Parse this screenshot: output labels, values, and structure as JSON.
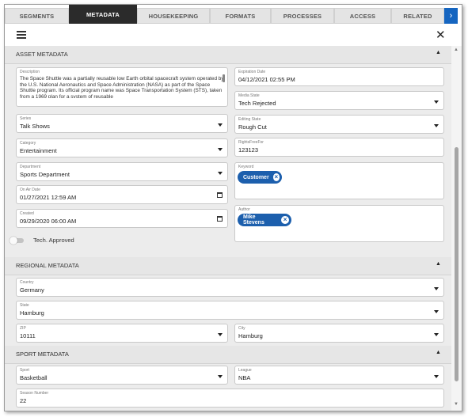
{
  "tabs": [
    "SEGMENTS",
    "METADATA",
    "HOUSEKEEPING",
    "FORMATS",
    "PROCESSES",
    "ACCESS",
    "RELATED"
  ],
  "active_tab": "METADATA",
  "asset_metadata": {
    "title": "ASSET METADATA",
    "description": {
      "label": "Description",
      "value": "The Space Shuttle was a partially reusable low Earth orbital spacecraft system operated by the U.S. National Aeronautics and Space Administration (NASA) as part of the Space Shuttle program. Its official program name was Space Transportation System (STS), taken from a 1969 plan for a system of reusable"
    },
    "series": {
      "label": "Series",
      "value": "Talk Shows"
    },
    "category": {
      "label": "Category",
      "value": "Entertainment"
    },
    "department": {
      "label": "Department",
      "value": "Sports Department"
    },
    "on_air_date": {
      "label": "On Air Date",
      "value": "01/27/2021 12:59 AM"
    },
    "created": {
      "label": "Created",
      "value": "09/29/2020 06:00 AM"
    },
    "tech_approved": {
      "label": "Tech. Approved",
      "value": false
    },
    "expiration_date": {
      "label": "Expiration Date",
      "value": "04/12/2021 02:55 PM"
    },
    "media_state": {
      "label": "Media State",
      "value": "Tech Rejected"
    },
    "editing_state": {
      "label": "Editing State",
      "value": "Rough Cut"
    },
    "rights_free_for": {
      "label": "RightsFreeFor",
      "value": "123123"
    },
    "keyword": {
      "label": "Keyword",
      "chips": [
        "Customer"
      ]
    },
    "author": {
      "label": "Author",
      "chips": [
        "Mike Stevens"
      ]
    }
  },
  "regional_metadata": {
    "title": "REGIONAL METADATA",
    "country": {
      "label": "Country",
      "value": "Germany"
    },
    "state": {
      "label": "State",
      "value": "Hamburg"
    },
    "zip": {
      "label": "ZIP",
      "value": "10111"
    },
    "city": {
      "label": "City",
      "value": "Hamburg"
    }
  },
  "sport_metadata": {
    "title": "SPORT METADATA",
    "sport": {
      "label": "Sport",
      "value": "Basketball"
    },
    "league": {
      "label": "League",
      "value": "NBA"
    },
    "season_number": {
      "label": "Season Number",
      "value": "22"
    }
  },
  "colors": {
    "accent": "#1c5fad",
    "active_tab": "#2b2b2b",
    "nav_button": "#1565c0",
    "panel_bg": "#ececec"
  },
  "icons": {
    "menu": "hamburger-icon",
    "close": "close-icon",
    "next": "chevron-right-icon",
    "collapse": "caret-up-icon",
    "dropdown": "caret-down-icon",
    "calendar": "calendar-icon",
    "chip_remove": "remove-circle-icon"
  }
}
